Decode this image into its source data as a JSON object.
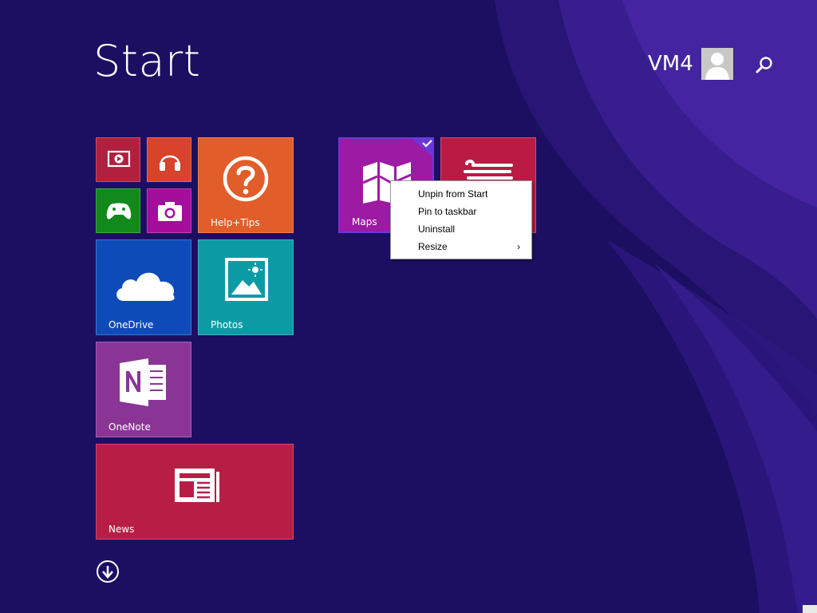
{
  "screen": {
    "title": "Start",
    "user_name": "VM4"
  },
  "icons": {
    "avatar": "user-icon",
    "search": "search-icon",
    "scroll_down": "arrow-down-circle-icon"
  },
  "tiles": [
    {
      "id": "video",
      "label": "",
      "icon": "video-icon",
      "color": "#b1203f"
    },
    {
      "id": "music",
      "label": "",
      "icon": "headphones-icon",
      "color": "#d7432b"
    },
    {
      "id": "games",
      "label": "",
      "icon": "xbox-controller-icon",
      "color": "#12891b"
    },
    {
      "id": "camera",
      "label": "",
      "icon": "camera-icon",
      "color": "#a50d9b"
    },
    {
      "id": "help-tips",
      "label": "Help+Tips",
      "icon": "question-icon",
      "color": "#e15d29"
    },
    {
      "id": "onedrive",
      "label": "OneDrive",
      "icon": "cloud-icon",
      "color": "#0d4cb8"
    },
    {
      "id": "photos",
      "label": "Photos",
      "icon": "photo-icon",
      "color": "#0c9ba5"
    },
    {
      "id": "onenote",
      "label": "OneNote",
      "icon": "onenote-icon",
      "color": "#8a3596"
    },
    {
      "id": "news",
      "label": "News",
      "icon": "newspaper-icon",
      "color": "#b81e45"
    },
    {
      "id": "maps",
      "label": "Maps",
      "icon": "map-icon",
      "color": "#9d1aa2",
      "selected": true
    },
    {
      "id": "weather",
      "label": "",
      "icon": "wind-icon",
      "color": "#b91b45"
    }
  ],
  "context_menu": {
    "items": [
      {
        "label": "Unpin from Start",
        "has_submenu": false
      },
      {
        "label": "Pin to taskbar",
        "has_submenu": false
      },
      {
        "label": "Uninstall",
        "has_submenu": false
      },
      {
        "label": "Resize",
        "has_submenu": true,
        "arrow": "›"
      }
    ]
  }
}
